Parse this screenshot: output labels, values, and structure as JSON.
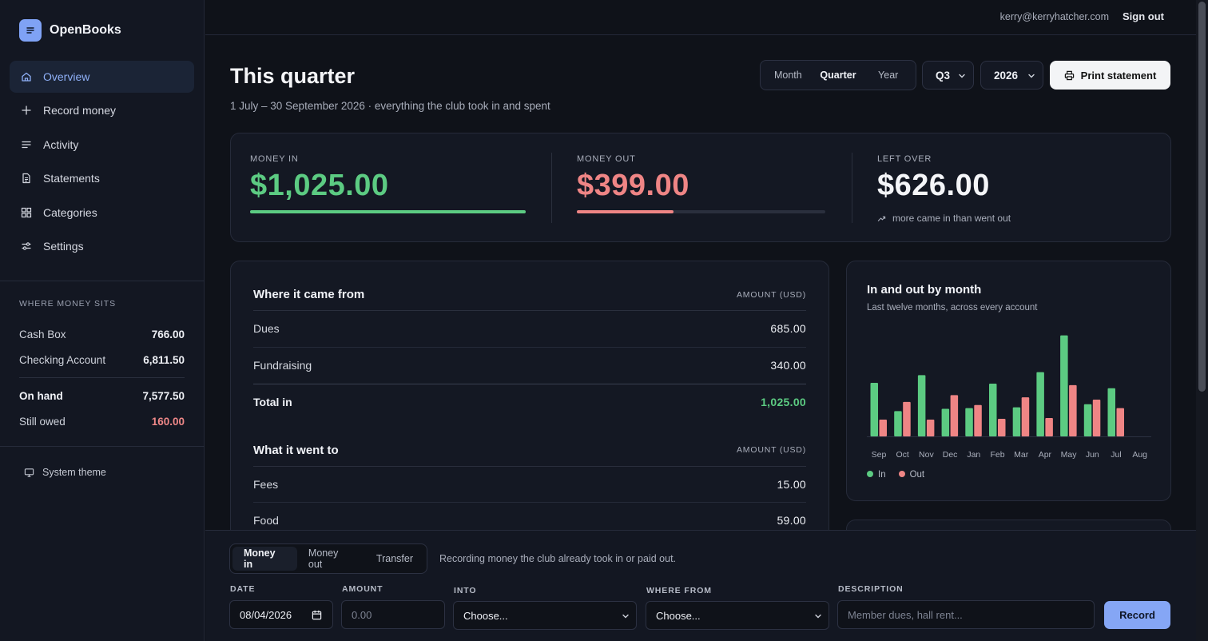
{
  "app": {
    "name": "OpenBooks"
  },
  "nav": [
    {
      "label": "Overview",
      "icon": "home-icon",
      "active": true
    },
    {
      "label": "Record money",
      "icon": "plus-icon"
    },
    {
      "label": "Activity",
      "icon": "lines-icon"
    },
    {
      "label": "Statements",
      "icon": "document-icon"
    },
    {
      "label": "Categories",
      "icon": "grid-icon"
    },
    {
      "label": "Settings",
      "icon": "sliders-icon"
    }
  ],
  "where_money_sits": {
    "title": "WHERE MONEY SITS",
    "accounts": [
      {
        "label": "Cash Box",
        "value": "766.00"
      },
      {
        "label": "Checking Account",
        "value": "6,811.50"
      }
    ],
    "on_hand": {
      "label": "On hand",
      "value": "7,577.50"
    },
    "still_owed": {
      "label": "Still owed",
      "value": "160.00"
    }
  },
  "theme_label": "System theme",
  "topbar": {
    "email": "kerry@kerryhatcher.com",
    "signout": "Sign out"
  },
  "header": {
    "title": "This quarter",
    "subtitle": "1 July – 30 September 2026 · everything the club took in and spent",
    "periods": [
      "Month",
      "Quarter",
      "Year"
    ],
    "active_period": "Quarter",
    "quarter": "Q3",
    "year": "2026",
    "print_label": "Print statement"
  },
  "summary": {
    "money_in": {
      "label": "MONEY IN",
      "value": "$1,025.00",
      "fill": 1.0,
      "color": "#5ccb82"
    },
    "money_out": {
      "label": "MONEY OUT",
      "value": "$399.00",
      "fill": 0.389,
      "color": "#ef8585"
    },
    "left_over": {
      "label": "LEFT OVER",
      "value": "$626.00",
      "note": "more came in than went out"
    }
  },
  "income": {
    "title": "Where it came from",
    "column": "AMOUNT (USD)",
    "rows": [
      {
        "label": "Dues",
        "value": "685.00"
      },
      {
        "label": "Fundraising",
        "value": "340.00"
      }
    ],
    "total": {
      "label": "Total in",
      "value": "1,025.00"
    }
  },
  "expenses": {
    "title": "What it went to",
    "column": "AMOUNT (USD)",
    "rows": [
      {
        "label": "Fees",
        "value": "15.00"
      },
      {
        "label": "Food",
        "value": "59.00"
      }
    ]
  },
  "chart_card": {
    "title": "In and out by month",
    "subtitle": "Last twelve months, across every account"
  },
  "chart_data": {
    "type": "bar",
    "categories": [
      "Sep",
      "Oct",
      "Nov",
      "Dec",
      "Jan",
      "Feb",
      "Mar",
      "Apr",
      "May",
      "Jun",
      "Jul",
      "Aug"
    ],
    "series": [
      {
        "name": "In",
        "color": "#5ccb82",
        "values": [
          70,
          33,
          80,
          36,
          37,
          69,
          38,
          84,
          132,
          42,
          63,
          0
        ]
      },
      {
        "name": "Out",
        "color": "#ef8585",
        "values": [
          22,
          45,
          22,
          54,
          41,
          23,
          51,
          24,
          67,
          48,
          37,
          0
        ]
      }
    ],
    "ylim": [
      0,
      140
    ],
    "grid": false,
    "legend": "bottom-left"
  },
  "form": {
    "tabs": [
      "Money in",
      "Money out",
      "Transfer"
    ],
    "active_tab": "Money in",
    "note": "Recording money the club already took in or paid out.",
    "date": {
      "label": "DATE",
      "value": "08/04/2026"
    },
    "amount": {
      "label": "AMOUNT",
      "placeholder": "0.00"
    },
    "into": {
      "label": "INTO",
      "value": "Choose..."
    },
    "where_from": {
      "label": "WHERE FROM",
      "value": "Choose..."
    },
    "description": {
      "label": "DESCRIPTION",
      "placeholder": "Member dues, hall rent..."
    },
    "record_label": "Record"
  }
}
